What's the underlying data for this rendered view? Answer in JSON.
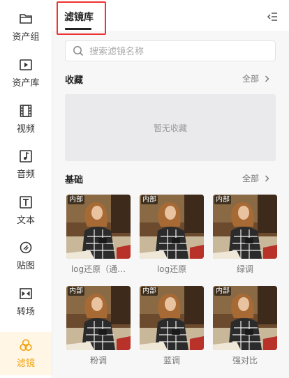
{
  "sidebar": {
    "items": [
      {
        "label": "资产组",
        "icon": "folder-icon",
        "active": false
      },
      {
        "label": "资产库",
        "icon": "play-box-icon",
        "active": false
      },
      {
        "label": "视频",
        "icon": "film-icon",
        "active": false
      },
      {
        "label": "音频",
        "icon": "music-note-icon",
        "active": false
      },
      {
        "label": "文本",
        "icon": "text-t-icon",
        "active": false
      },
      {
        "label": "贴图",
        "icon": "sticker-icon",
        "active": false
      },
      {
        "label": "转场",
        "icon": "transition-icon",
        "active": false
      },
      {
        "label": "滤镜",
        "icon": "filter-circles-icon",
        "active": true
      }
    ],
    "active_color": "#f2a20c"
  },
  "header": {
    "title": "滤镜库",
    "collapse_icon": "collapse-panel-icon"
  },
  "search": {
    "placeholder": "搜索滤镜名称",
    "value": ""
  },
  "favorites": {
    "title": "收藏",
    "see_all": "全部",
    "empty_text": "暂无收藏"
  },
  "basic": {
    "title": "基础",
    "see_all": "全部",
    "items": [
      {
        "label": "log还原（通…",
        "badge": "内部"
      },
      {
        "label": "log还原",
        "badge": "内部"
      },
      {
        "label": "绿调",
        "badge": "内部"
      },
      {
        "label": "粉调",
        "badge": "内部"
      },
      {
        "label": "蓝调",
        "badge": "内部"
      },
      {
        "label": "强对比",
        "badge": "内部"
      }
    ]
  }
}
